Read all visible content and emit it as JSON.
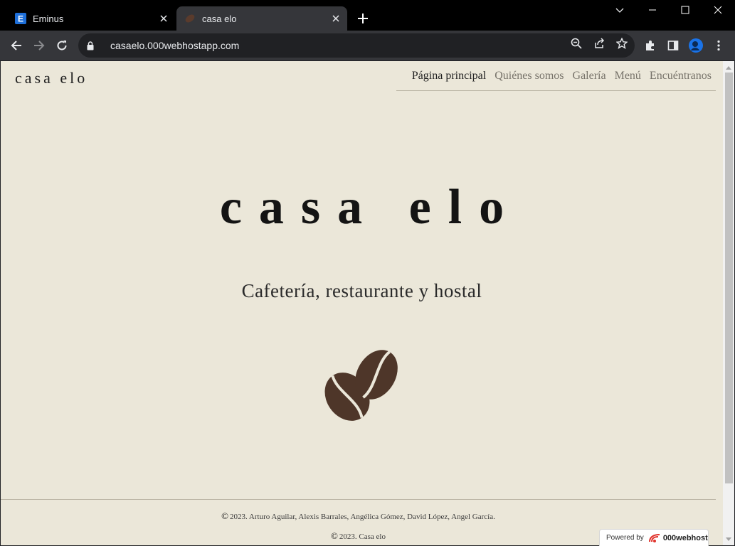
{
  "browser": {
    "tabs": [
      {
        "title": "Eminus",
        "favicon_letter": "E",
        "active": false
      },
      {
        "title": "casa elo",
        "active": true
      }
    ],
    "url": "casaelo.000webhostapp.com"
  },
  "site": {
    "brand": "casa elo",
    "nav": [
      {
        "label": "Página principal",
        "current": true
      },
      {
        "label": "Quiénes somos",
        "current": false
      },
      {
        "label": "Galería",
        "current": false
      },
      {
        "label": "Menú",
        "current": false
      },
      {
        "label": "Encuéntranos",
        "current": false
      }
    ],
    "hero_title": "casa elo",
    "subtitle": "Cafetería, restaurante y hostal",
    "footer": {
      "credits": "2023. Arturo Aguilar, Alexis Barrales, Angélica Gómez, David López, Angel García.",
      "copyright": "2023. Casa elo",
      "copyright_symbol": "©"
    },
    "powered_by": {
      "prefix": "Powered by",
      "brand": "000webhost"
    }
  },
  "colors": {
    "page_background": "#ebe7d9",
    "coffee_bean": "#4e3629",
    "nav_inactive": "#77736a",
    "tab_strip": "#000000",
    "toolbar": "#35363a"
  },
  "icons": {
    "beans": "coffee-beans-icon"
  }
}
